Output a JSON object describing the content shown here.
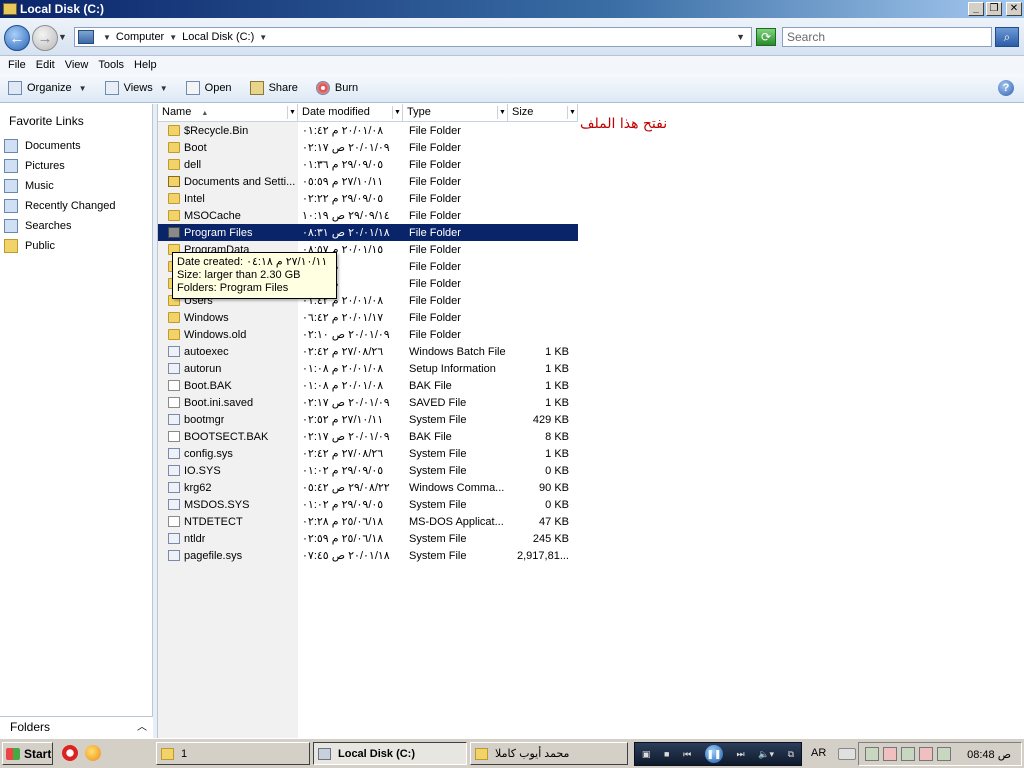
{
  "window": {
    "title": "Local Disk (C:)"
  },
  "address": {
    "crumbs": [
      "Computer",
      "Local Disk (C:)"
    ],
    "search_placeholder": "Search"
  },
  "menu": [
    "File",
    "Edit",
    "View",
    "Tools",
    "Help"
  ],
  "toolbar": {
    "organize": "Organize",
    "views": "Views",
    "open": "Open",
    "share": "Share",
    "burn": "Burn"
  },
  "nav": {
    "heading": "Favorite Links",
    "items": [
      "Documents",
      "Pictures",
      "Music",
      "Recently Changed",
      "Searches",
      "Public"
    ],
    "folders_label": "Folders"
  },
  "columns": {
    "name": "Name",
    "date": "Date modified",
    "type": "Type",
    "size": "Size"
  },
  "files": [
    {
      "name": "$Recycle.Bin",
      "date": "٢٠/٠١/٠٨ م ٠١:٤٢",
      "type": "File Folder",
      "size": "",
      "icon": "folder"
    },
    {
      "name": "Boot",
      "date": "٢٠/٠١/٠٩ ص ٠٢:١٧",
      "type": "File Folder",
      "size": "",
      "icon": "folder"
    },
    {
      "name": "dell",
      "date": "٢٩/٠٩/٠٥ م ٠١:٣٦",
      "type": "File Folder",
      "size": "",
      "icon": "folder"
    },
    {
      "name": "Documents and Setti...",
      "date": "٢٧/١٠/١١ م ٠٥:٥٩",
      "type": "File Folder",
      "size": "",
      "icon": "shortcut"
    },
    {
      "name": "Intel",
      "date": "٢٩/٠٩/٠٥ م ٠٢:٢٢",
      "type": "File Folder",
      "size": "",
      "icon": "folder"
    },
    {
      "name": "MSOCache",
      "date": "٢٩/٠٩/١٤ ص ١٠:١٩",
      "type": "File Folder",
      "size": "",
      "icon": "folder"
    },
    {
      "name": "Program Files",
      "date": "٢٠/٠١/١٨ ص ٠٨:٣١",
      "type": "File Folder",
      "size": "",
      "icon": "selfolder",
      "selected": true
    },
    {
      "name": "ProgramData",
      "date": "٢٠/٠١/١٥ م ٠٨:٥٧",
      "type": "File Folder",
      "size": "",
      "icon": "folder"
    },
    {
      "name": "",
      "date": "م ٠٧:٢٥",
      "type": "File Folder",
      "size": "",
      "icon": "folder"
    },
    {
      "name": "",
      "date": "م ٠٦:٤٢",
      "type": "File Folder",
      "size": "",
      "icon": "folder"
    },
    {
      "name": "Users",
      "date": "٢٠/٠١/٠٨ م ٠١:٤٢",
      "type": "File Folder",
      "size": "",
      "icon": "folder"
    },
    {
      "name": "Windows",
      "date": "٢٠/٠١/١٧ م ٠٦:٤٢",
      "type": "File Folder",
      "size": "",
      "icon": "folder"
    },
    {
      "name": "Windows.old",
      "date": "٢٠/٠١/٠٩ ص ٠٢:١٠",
      "type": "File Folder",
      "size": "",
      "icon": "folder"
    },
    {
      "name": "autoexec",
      "date": "٢٧/٠٨/٢٦ م ٠٢:٤٢",
      "type": "Windows Batch File",
      "size": "1 KB",
      "icon": "sysfile"
    },
    {
      "name": "autorun",
      "date": "٢٠/٠١/٠٨ م ٠١:٠٨",
      "type": "Setup Information",
      "size": "1 KB",
      "icon": "sysfile"
    },
    {
      "name": "Boot.BAK",
      "date": "٢٠/٠١/٠٨ م ٠١:٠٨",
      "type": "BAK File",
      "size": "1 KB",
      "icon": "file"
    },
    {
      "name": "Boot.ini.saved",
      "date": "٢٠/٠١/٠٩ ص ٠٢:١٧",
      "type": "SAVED File",
      "size": "1 KB",
      "icon": "file"
    },
    {
      "name": "bootmgr",
      "date": "٢٧/١٠/١١ م ٠٢:٥٢",
      "type": "System File",
      "size": "429 KB",
      "icon": "sysfile"
    },
    {
      "name": "BOOTSECT.BAK",
      "date": "٢٠/٠١/٠٩ ص ٠٢:١٧",
      "type": "BAK File",
      "size": "8 KB",
      "icon": "file"
    },
    {
      "name": "config.sys",
      "date": "٢٧/٠٨/٢٦ م ٠٢:٤٢",
      "type": "System File",
      "size": "1 KB",
      "icon": "sysfile"
    },
    {
      "name": "IO.SYS",
      "date": "٢٩/٠٩/٠٥ م ٠١:٠٢",
      "type": "System File",
      "size": "0 KB",
      "icon": "sysfile"
    },
    {
      "name": "krg62",
      "date": "٢٩/٠٨/٢٢ ص ٠٥:٤٢",
      "type": "Windows Comma...",
      "size": "90 KB",
      "icon": "sysfile"
    },
    {
      "name": "MSDOS.SYS",
      "date": "٢٩/٠٩/٠٥ م ٠١:٠٢",
      "type": "System File",
      "size": "0 KB",
      "icon": "sysfile"
    },
    {
      "name": "NTDETECT",
      "date": "٢٥/٠٦/١٨ م ٠٢:٢٨",
      "type": "MS-DOS Applicat...",
      "size": "47 KB",
      "icon": "file"
    },
    {
      "name": "ntldr",
      "date": "٢٥/٠٦/١٨ م ٠٢:٥٩",
      "type": "System File",
      "size": "245 KB",
      "icon": "sysfile"
    },
    {
      "name": "pagefile.sys",
      "date": "٢٠/٠١/١٨ ص ٠٧:٤٥",
      "type": "System File",
      "size": "2,917,81...",
      "icon": "sysfile"
    }
  ],
  "tooltip": {
    "line1": "Date created: ٢٧/١٠/١١ م ٠٤:١٨",
    "line2": "Size: larger than 2.30 GB",
    "line3": "Folders: Program Files"
  },
  "annotation": "نفتح هذا الملف",
  "taskbar": {
    "start": "Start",
    "tasks": [
      "1",
      "Local Disk (C:)",
      "محمد أيوب كاملا"
    ],
    "lang": "AR",
    "clock": "ص 08:48"
  },
  "colors": {
    "selection": "#0a246a",
    "annotation": "#c00000",
    "tooltip_bg": "#ffffe1"
  }
}
